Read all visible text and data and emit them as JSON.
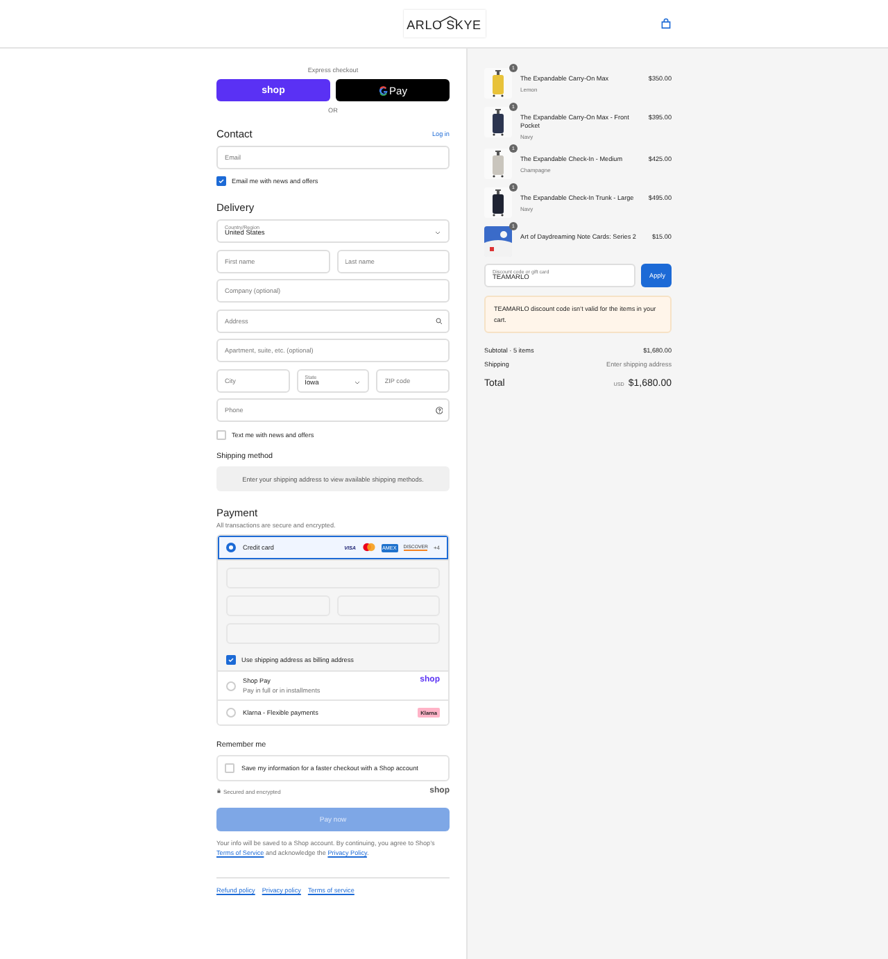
{
  "header": {
    "logo": "ARLO SKYE"
  },
  "express": {
    "title": "Express checkout",
    "buttons": [
      {
        "kind": "shop",
        "label": "shop"
      },
      {
        "kind": "gpay",
        "label": "Pay"
      }
    ],
    "divider": "OR"
  },
  "contact": {
    "heading": "Contact",
    "login": "Log in",
    "email": {
      "placeholder": "Email"
    },
    "newsletter": {
      "label": "Email me with news and offers",
      "checked": true
    }
  },
  "delivery": {
    "heading": "Delivery",
    "rows": [
      [
        {
          "kind": "select",
          "label": "Country/Region",
          "value": "United States"
        }
      ],
      [
        {
          "kind": "input",
          "placeholder": "First name"
        },
        {
          "kind": "input",
          "placeholder": "Last name"
        }
      ],
      [
        {
          "kind": "input",
          "placeholder": "Company (optional)"
        }
      ],
      [
        {
          "kind": "search",
          "placeholder": "Address"
        }
      ],
      [
        {
          "kind": "input",
          "placeholder": "Apartment, suite, etc. (optional)"
        }
      ],
      [
        {
          "kind": "input",
          "placeholder": "City"
        },
        {
          "kind": "select",
          "label": "State",
          "value": "Iowa"
        },
        {
          "kind": "input",
          "placeholder": "ZIP code"
        }
      ],
      [
        {
          "kind": "help",
          "placeholder": "Phone"
        }
      ]
    ],
    "sms": {
      "label": "Text me with news and offers",
      "checked": false
    }
  },
  "shipping": {
    "heading": "Shipping method",
    "note": "Enter your shipping address to view available shipping methods."
  },
  "payment": {
    "heading": "Payment",
    "subtitle": "All transactions are secure and encrypted.",
    "methods": [
      {
        "kind": "card",
        "label": "Credit card",
        "selected": true,
        "brands": [
          {
            "kind": "visa",
            "label": "VISA"
          },
          {
            "kind": "mastercard"
          },
          {
            "kind": "amex",
            "label": "AMEX"
          },
          {
            "kind": "discover",
            "label": "DISCOVER"
          }
        ],
        "more": "+4",
        "billing": {
          "label": "Use shipping address as billing address",
          "checked": true
        }
      },
      {
        "kind": "shoppay",
        "label": "Shop Pay",
        "sublabel": "Pay in full or in installments",
        "badge": "shop",
        "selected": false
      },
      {
        "kind": "klarna",
        "label": "Klarna - Flexible payments",
        "badge": "Klarna",
        "selected": false
      }
    ]
  },
  "remember": {
    "heading": "Remember me",
    "option": {
      "label": "Save my information for a faster checkout with a Shop account",
      "checked": false
    },
    "secure": "Secured and encrypted",
    "brand": "shop"
  },
  "pay_button": "Pay now",
  "consent": {
    "before": "Your info will be saved to a Shop account. By continuing, you agree to Shop’s ",
    "terms": "Terms of Service",
    "middle": " and acknowledge the ",
    "privacy": "Privacy Policy",
    "after": "."
  },
  "footer_links": [
    "Refund policy",
    "Privacy policy",
    "Terms of service"
  ],
  "cart": {
    "items": [
      {
        "qty": "1",
        "name": "The Expandable Carry-On Max",
        "variant": "Lemon",
        "price": "$350.00"
      },
      {
        "qty": "1",
        "name": "The Expandable Carry-On Max - Front Pocket",
        "variant": "Navy",
        "price": "$395.00"
      },
      {
        "qty": "1",
        "name": "The Expandable Check-In - Medium",
        "variant": "Champagne",
        "price": "$425.00"
      },
      {
        "qty": "1",
        "name": "The Expandable Check-In Trunk - Large",
        "variant": "Navy",
        "price": "$495.00"
      },
      {
        "qty": "1",
        "name": "Art of Daydreaming Note Cards: Series 2",
        "price": "$15.00"
      }
    ],
    "discount": {
      "label": "Discount code or gift card",
      "value": "TEAMARLO",
      "button": "Apply"
    },
    "alert": "TEAMARLO discount code isn’t valid for the items in your cart.",
    "subtotal": {
      "label": "Subtotal · 5 items",
      "value": "$1,680.00"
    },
    "shipping": {
      "label": "Shipping",
      "value": "Enter shipping address"
    },
    "total": {
      "label": "Total",
      "currency": "USD",
      "value": "$1,680.00"
    }
  }
}
